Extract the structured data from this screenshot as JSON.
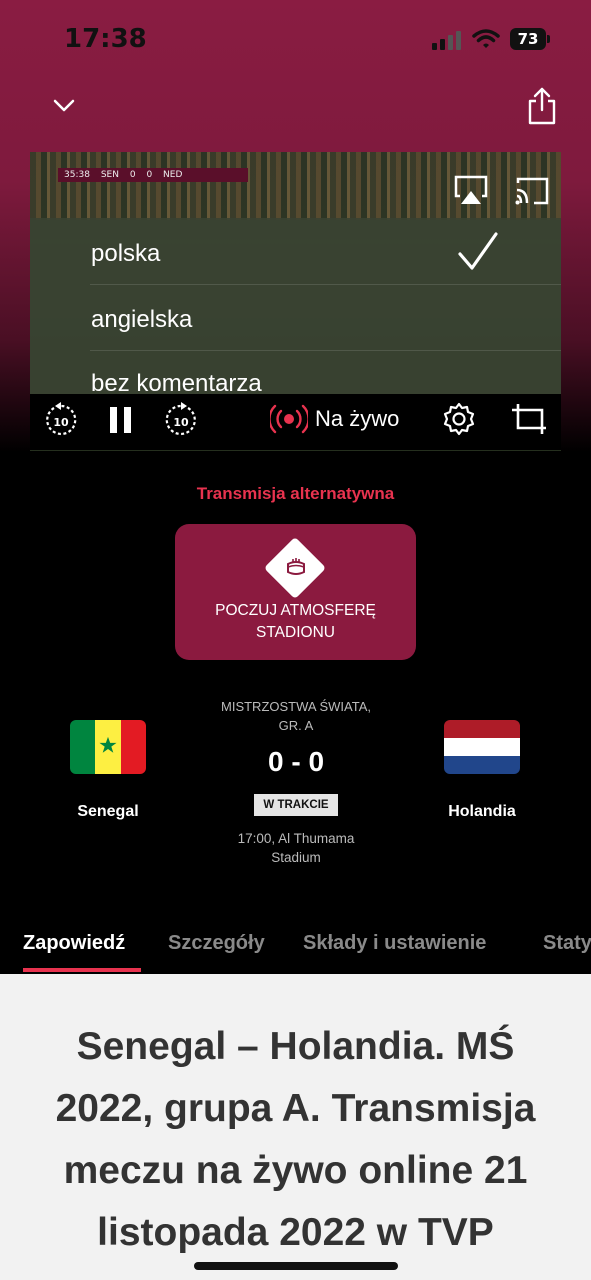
{
  "status_bar": {
    "time": "17:38",
    "battery": "73"
  },
  "player": {
    "scorebug": {
      "clock": "35:38",
      "home": "SEN",
      "home_score": "0",
      "away_score": "0",
      "away": "NED"
    },
    "audio_menu": {
      "options": [
        "polska",
        "angielska",
        "bez komentarza"
      ],
      "selected_index": 0
    },
    "controls": {
      "rewind_seconds": "10",
      "forward_seconds": "10",
      "live_label": "Na żywo"
    }
  },
  "alt_broadcast": {
    "title": "Transmisja alternatywna",
    "button_line1": "POCZUJ ATMOSFERĘ",
    "button_line2": "STADIONU"
  },
  "match": {
    "competition_line1": "MISTRZOSTWA ŚWIATA,",
    "competition_line2": "GR. A",
    "score": "0 - 0",
    "status": "W TRAKCIE",
    "time_venue_line1": "17:00, Al Thumama",
    "time_venue_line2": "Stadium",
    "home_team": "Senegal",
    "away_team": "Holandia"
  },
  "tabs": [
    {
      "label": "Zapowiedź",
      "active": true
    },
    {
      "label": "Szczegóły",
      "active": false
    },
    {
      "label": "Składy i ustawienie",
      "active": false
    },
    {
      "label": "Statystyki",
      "active": false
    }
  ],
  "article": {
    "title": "Senegal – Holandia. MŚ 2022, grupa A. Transmisja meczu na żywo online 21 listopada 2022 w TVP"
  },
  "colors": {
    "brand": "#8b1a3f",
    "accent": "#e8334f",
    "senegal_green": "#00853f",
    "senegal_yellow": "#fdef42",
    "senegal_red": "#e31b23",
    "netherlands_red": "#ae1c28",
    "netherlands_blue": "#21468b"
  }
}
